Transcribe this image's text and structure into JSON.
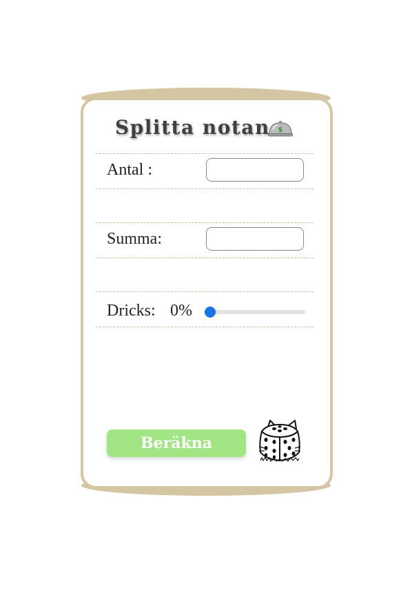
{
  "title": "Splitta notan",
  "icons": {
    "title_icon": "cloche-icon",
    "corner_icon": "cat-dice-icon"
  },
  "form": {
    "antal": {
      "label": "Antal :",
      "value": "",
      "placeholder": ""
    },
    "summa": {
      "label": "Summa:",
      "value": "",
      "placeholder": ""
    },
    "dricks": {
      "label": "Dricks:",
      "value_text": "0%",
      "value_percent": 0,
      "max_percent": 100
    }
  },
  "button": {
    "label": "Beräkna"
  },
  "colors": {
    "frame": "#d4c6a3",
    "divider": "#d9b99b",
    "button_bg": "#a2e584",
    "slider_accent": "#1a73e8",
    "cloche_sign": "#2e9b3a"
  }
}
